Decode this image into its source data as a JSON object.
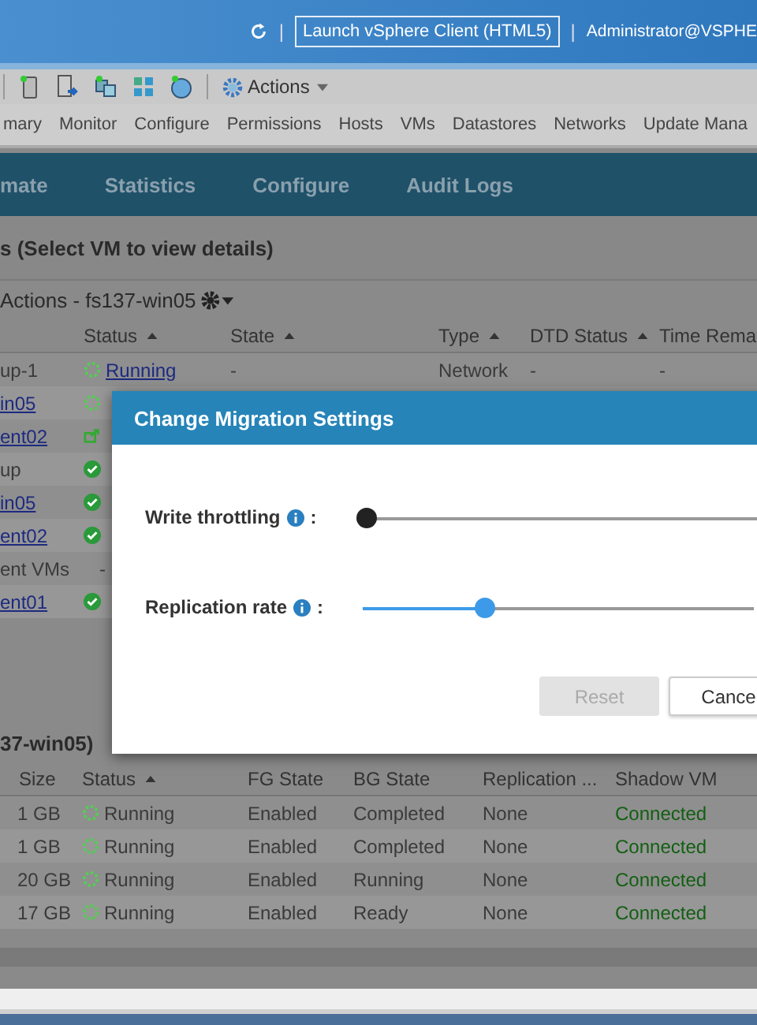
{
  "header": {
    "separators": [
      "|",
      "|"
    ],
    "launch_button": "Launch vSphere Client (HTML5)",
    "user": "Administrator@VSPHE"
  },
  "toolbar": {
    "actions": "Actions"
  },
  "object_tabs": [
    "mary",
    "Monitor",
    "Configure",
    "Permissions",
    "Hosts",
    "VMs",
    "Datastores",
    "Networks",
    "Update Mana"
  ],
  "nav_tabs": [
    "mate",
    "Statistics",
    "Configure",
    "Audit Logs"
  ],
  "vm_panel": {
    "title": "s (Select VM to view details)",
    "actions": "Actions - fs137-win05",
    "columns": [
      {
        "label": "Status",
        "sorted": true
      },
      {
        "label": "State",
        "sorted": true
      },
      {
        "label": "Type",
        "sorted": true
      },
      {
        "label": "DTD Status",
        "sorted": true
      },
      {
        "label": "Time Rema"
      }
    ],
    "rows": [
      {
        "name": "up-1",
        "link": false,
        "kind": "running",
        "status": "Running",
        "state": "-",
        "type": "Network",
        "dtd": "-",
        "time": "-"
      },
      {
        "name": "in05",
        "link": true,
        "kind": "running"
      },
      {
        "name": "ent02",
        "link": true,
        "kind": "migrating"
      },
      {
        "name": "up",
        "link": false,
        "kind": "ok"
      },
      {
        "name": "in05",
        "link": true,
        "kind": "ok"
      },
      {
        "name": "ent02",
        "link": true,
        "kind": "ok"
      },
      {
        "name": "ent VMs",
        "link": false,
        "kind": "none",
        "status": "-"
      },
      {
        "name": "ent01",
        "link": true,
        "kind": "ok"
      }
    ]
  },
  "disk_panel": {
    "title": "37-win05)",
    "columns": [
      {
        "label": "Size",
        "sorted": false
      },
      {
        "label": "Status",
        "sorted": true
      },
      {
        "label": "FG State",
        "sorted": false
      },
      {
        "label": "BG State",
        "sorted": false
      },
      {
        "label": "Replication ...",
        "sorted": false
      },
      {
        "label": "Shadow VM",
        "sorted": false
      }
    ],
    "rows": [
      {
        "size": "1 GB",
        "status": "Running",
        "fg": "Enabled",
        "bg": "Completed",
        "replication": "None",
        "shadow": "Connected"
      },
      {
        "size": "1 GB",
        "status": "Running",
        "fg": "Enabled",
        "bg": "Completed",
        "replication": "None",
        "shadow": "Connected"
      },
      {
        "size": "20 GB",
        "status": "Running",
        "fg": "Enabled",
        "bg": "Running",
        "replication": "None",
        "shadow": "Connected"
      },
      {
        "size": "17 GB",
        "status": "Running",
        "fg": "Enabled",
        "bg": "Ready",
        "replication": "None",
        "shadow": "Connected"
      }
    ]
  },
  "dialog": {
    "title": "Change Migration Settings",
    "sliders": [
      {
        "label": "Write throttling",
        "colon": ":",
        "level": 0
      },
      {
        "label": "Replication rate",
        "colon": ":",
        "level": 0.31
      }
    ],
    "buttons": [
      {
        "label": "Reset",
        "disabled": true
      },
      {
        "label": "Cance",
        "disabled": false
      }
    ]
  }
}
